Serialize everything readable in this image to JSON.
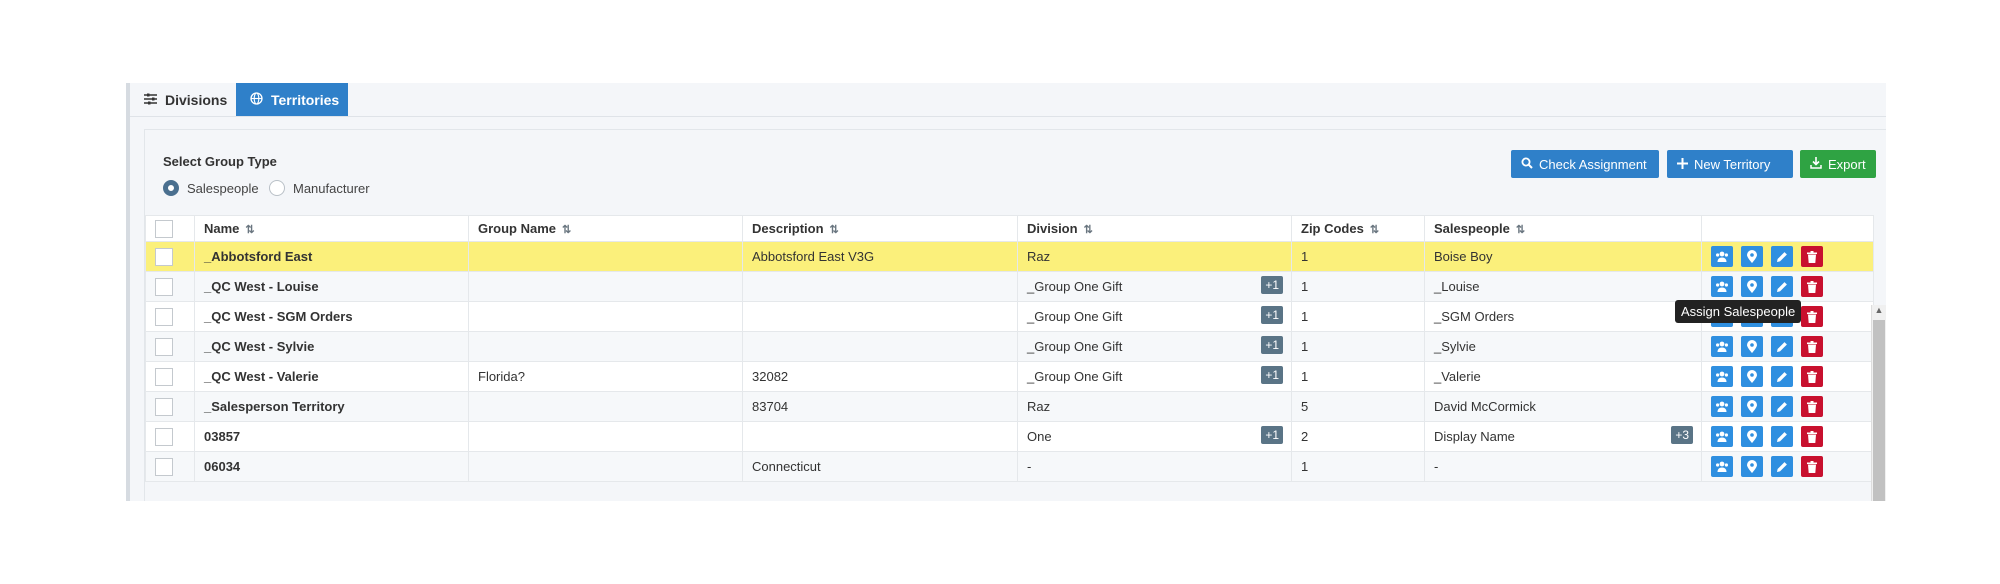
{
  "tabs": [
    {
      "label": "Divisions",
      "icon": "sliders-icon",
      "active": false
    },
    {
      "label": "Territories",
      "icon": "globe-icon",
      "active": true
    }
  ],
  "group_type": {
    "label": "Select Group Type",
    "options": [
      {
        "label": "Salespeople",
        "selected": true
      },
      {
        "label": "Manufacturer",
        "selected": false
      }
    ]
  },
  "toolbar": {
    "check_assignment": "Check Assignment",
    "new_territory": "New Territory",
    "export": "Export"
  },
  "tooltip": "Assign Salespeople",
  "columns": [
    "Name",
    "Group Name",
    "Description",
    "Division",
    "Zip Codes",
    "Salespeople"
  ],
  "rows": [
    {
      "name": "_Abbotsford East",
      "group": "",
      "desc": "Abbotsford East V3G",
      "division": "Raz",
      "div_more": "",
      "zip": "1",
      "sales": "Boise Boy",
      "sales_more": ""
    },
    {
      "name": "_QC West - Louise",
      "group": "",
      "desc": "",
      "division": "_Group One Gift",
      "div_more": "+1",
      "zip": "1",
      "sales": "_Louise",
      "sales_more": ""
    },
    {
      "name": "_QC West - SGM Orders",
      "group": "",
      "desc": "",
      "division": "_Group One Gift",
      "div_more": "+1",
      "zip": "1",
      "sales": "_SGM Orders",
      "sales_more": ""
    },
    {
      "name": "_QC West - Sylvie",
      "group": "",
      "desc": "",
      "division": "_Group One Gift",
      "div_more": "+1",
      "zip": "1",
      "sales": "_Sylvie",
      "sales_more": ""
    },
    {
      "name": "_QC West - Valerie",
      "group": "Florida?",
      "desc": "32082",
      "division": "_Group One Gift",
      "div_more": "+1",
      "zip": "1",
      "sales": "_Valerie",
      "sales_more": ""
    },
    {
      "name": "_Salesperson Territory",
      "group": "",
      "desc": "83704",
      "division": "Raz",
      "div_more": "",
      "zip": "5",
      "sales": "David McCormick",
      "sales_more": ""
    },
    {
      "name": "03857",
      "group": "",
      "desc": "",
      "division": "One",
      "div_more": "+1",
      "zip": "2",
      "sales": "Display Name",
      "sales_more": "+3"
    },
    {
      "name": "06034",
      "group": "",
      "desc": "Connecticut",
      "division": "-",
      "div_more": "",
      "zip": "1",
      "sales": "-",
      "sales_more": ""
    }
  ],
  "colors": {
    "primary": "#2f80c9",
    "success": "#2fa343",
    "danger": "#c8102e",
    "highlight": "#fbf07b"
  }
}
